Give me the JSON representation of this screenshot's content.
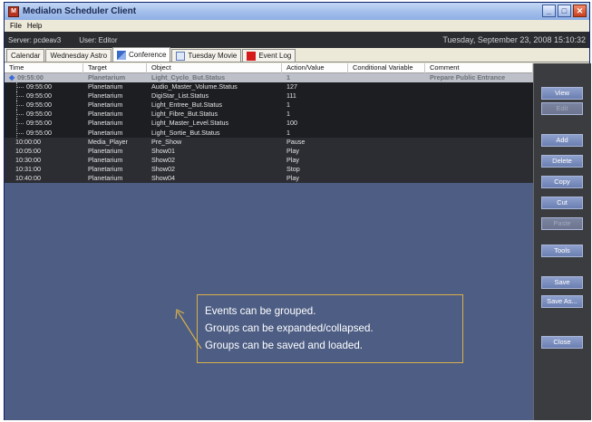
{
  "window": {
    "title": "Medialon Scheduler Client",
    "buttons": [
      "_",
      "□",
      "✕"
    ]
  },
  "menu": [
    "File",
    "Help"
  ],
  "status": {
    "server": "Server: pcdeav3",
    "user": "User: Editor",
    "datetime": "Tuesday, September 23, 2008 15:10:32"
  },
  "tabs": [
    {
      "label": "Calendar",
      "icon": "",
      "active": false
    },
    {
      "label": "Wednesday Astro",
      "icon": "",
      "active": false
    },
    {
      "label": "Conference",
      "icon": "chart-icon",
      "active": true
    },
    {
      "label": "Tuesday Movie",
      "icon": "document-icon",
      "active": false
    },
    {
      "label": "Event Log",
      "icon": "red-square-icon",
      "active": false
    }
  ],
  "table": {
    "headers": {
      "time": "Time",
      "target": "Target",
      "object": "Object",
      "action": "Action/Value",
      "conditional": "Conditional Variable",
      "comment": "Comment"
    },
    "rows": [
      {
        "kind": "group",
        "time": "09:55:00",
        "target": "Planetarium",
        "object": "Light_Cyclo_But.Status",
        "action": "1",
        "conditional": "",
        "comment": "Prepare Public Entrance"
      },
      {
        "kind": "child",
        "time": "09:55:00",
        "target": "Planetarium",
        "object": "Audio_Master_Volume.Status",
        "action": "127",
        "conditional": "",
        "comment": ""
      },
      {
        "kind": "child",
        "time": "09:55:00",
        "target": "Planetarium",
        "object": "DigiStar_List.Status",
        "action": "111",
        "conditional": "",
        "comment": ""
      },
      {
        "kind": "child",
        "time": "09:55:00",
        "target": "Planetarium",
        "object": "Light_Entree_But.Status",
        "action": "1",
        "conditional": "",
        "comment": ""
      },
      {
        "kind": "child",
        "time": "09:55:00",
        "target": "Planetarium",
        "object": "Light_Fibre_But.Status",
        "action": "1",
        "conditional": "",
        "comment": ""
      },
      {
        "kind": "child",
        "time": "09:55:00",
        "target": "Planetarium",
        "object": "Light_Master_Level.Status",
        "action": "100",
        "conditional": "",
        "comment": ""
      },
      {
        "kind": "child",
        "time": "09:55:00",
        "target": "Planetarium",
        "object": "Light_Sortie_But.Status",
        "action": "1",
        "conditional": "",
        "comment": ""
      },
      {
        "kind": "plain",
        "time": "10:00:00",
        "target": "Media_Player",
        "object": "Pre_Show",
        "action": "Pause",
        "conditional": "",
        "comment": ""
      },
      {
        "kind": "plain",
        "time": "10:05:00",
        "target": "Planetarium",
        "object": "Show01",
        "action": "Play",
        "conditional": "",
        "comment": ""
      },
      {
        "kind": "plain",
        "time": "10:30:00",
        "target": "Planetarium",
        "object": "Show02",
        "action": "Play",
        "conditional": "",
        "comment": ""
      },
      {
        "kind": "plain",
        "time": "10:31:00",
        "target": "Planetarium",
        "object": "Show02",
        "action": "Stop",
        "conditional": "",
        "comment": ""
      },
      {
        "kind": "plain",
        "time": "10:40:00",
        "target": "Planetarium",
        "object": "Show04",
        "action": "Play",
        "conditional": "",
        "comment": ""
      }
    ]
  },
  "side_buttons": [
    {
      "label": "View",
      "enabled": true
    },
    {
      "label": "Edit",
      "enabled": false
    },
    {
      "label": "Add",
      "enabled": true
    },
    {
      "label": "Delete",
      "enabled": true
    },
    {
      "label": "Copy",
      "enabled": true
    },
    {
      "label": "Cut",
      "enabled": true
    },
    {
      "label": "Paste",
      "enabled": false
    },
    {
      "label": "Tools",
      "enabled": true
    },
    {
      "label": "Save",
      "enabled": true
    },
    {
      "label": "Save As...",
      "enabled": true
    },
    {
      "label": "Close",
      "enabled": true
    }
  ],
  "annotation": {
    "lines": [
      "Events can be grouped.",
      "Groups can be expanded/collapsed.",
      "Groups can be saved and loaded."
    ],
    "border_color": "#d9b04a"
  },
  "colors": {
    "status_bar": "#2a2c30",
    "content_bg": "#4d5d84",
    "group_row": "#bdc0c8",
    "row_dark": "#2c2d33"
  }
}
